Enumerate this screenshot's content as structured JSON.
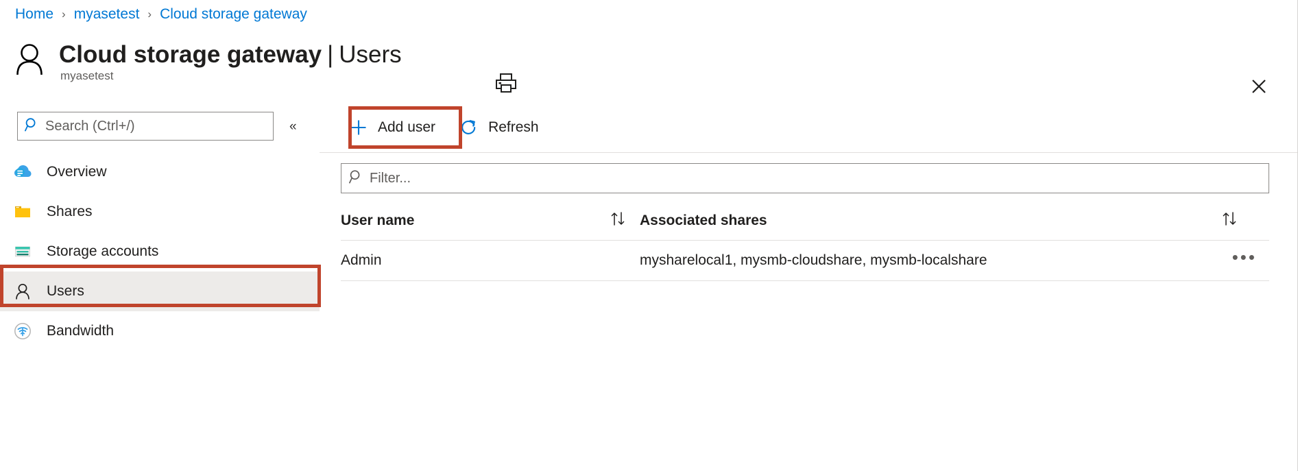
{
  "breadcrumb": {
    "items": [
      {
        "label": "Home"
      },
      {
        "label": "myasetest"
      },
      {
        "label": "Cloud storage gateway"
      }
    ],
    "separator": "›"
  },
  "header": {
    "title": "Cloud storage gateway",
    "title_separator": "|",
    "title_section": "Users",
    "subtitle": "myasetest",
    "avatar_icon": "person-icon",
    "print_icon": "print-icon",
    "close_icon": "close-icon"
  },
  "sidebar": {
    "search": {
      "placeholder": "Search (Ctrl+/)",
      "value": "",
      "icon": "search-icon"
    },
    "collapse_label": "«",
    "items": [
      {
        "label": "Overview",
        "icon": "cloud-icon",
        "selected": false
      },
      {
        "label": "Shares",
        "icon": "folder-icon",
        "selected": false
      },
      {
        "label": "Storage accounts",
        "icon": "storage-account-icon",
        "selected": false
      },
      {
        "label": "Users",
        "icon": "person-icon",
        "selected": true
      },
      {
        "label": "Bandwidth",
        "icon": "bandwidth-icon",
        "selected": false
      }
    ]
  },
  "toolbar": {
    "add_user_label": "Add user",
    "add_user_icon": "plus-icon",
    "refresh_label": "Refresh",
    "refresh_icon": "refresh-icon"
  },
  "filter": {
    "placeholder": "Filter...",
    "value": "",
    "icon": "search-icon"
  },
  "table": {
    "columns": [
      {
        "label": "User name",
        "sort_icon": "sort-updown-icon"
      },
      {
        "label": "Associated shares",
        "sort_icon": "sort-updown-icon"
      }
    ],
    "rows": [
      {
        "user_name": "Admin",
        "associated_shares": "mysharelocal1, mysmb-cloudshare, mysmb-localshare",
        "menu_icon": "ellipsis-icon",
        "menu_label": "•••"
      }
    ]
  },
  "annotations": {
    "highlight_color": "#c0442c",
    "boxes": [
      {
        "target": "sidebar-item-users"
      },
      {
        "target": "add-user-button"
      }
    ]
  },
  "colors": {
    "link": "#0078d4",
    "accent": "#0078d4",
    "selected_bg": "#edebe9",
    "border": "#e1dfdd",
    "text": "#201f1e",
    "muted_text": "#605e5c"
  }
}
